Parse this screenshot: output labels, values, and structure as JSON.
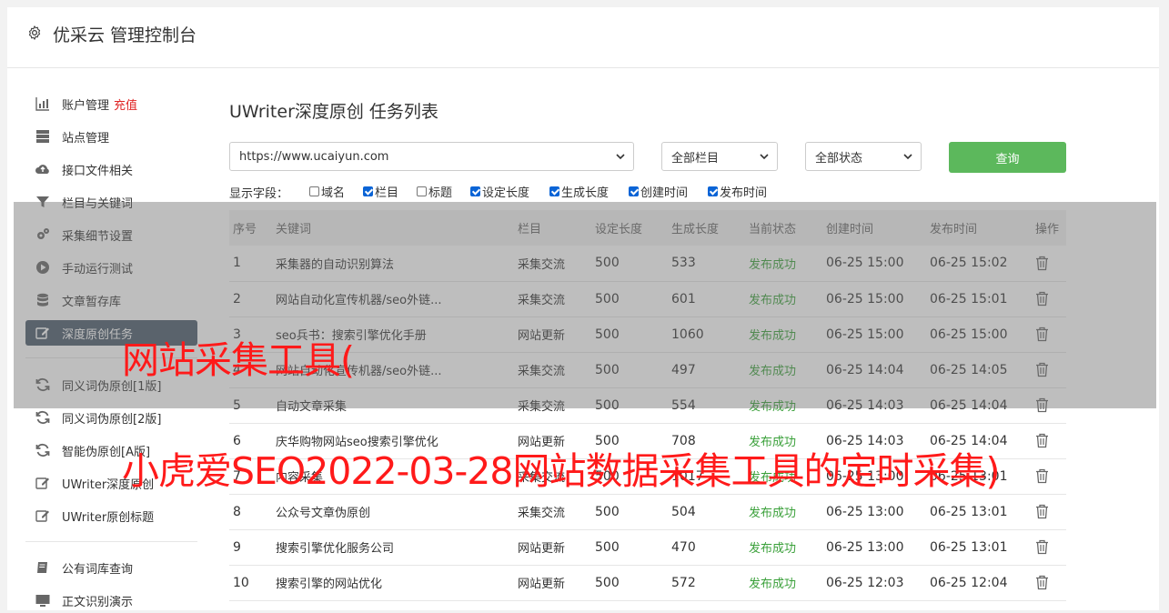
{
  "header": {
    "title": "优采云 管理控制台",
    "icon": "gear-icon"
  },
  "sidebar": {
    "items": [
      {
        "label": "账户管理",
        "badge": "充值",
        "icon": "bar-chart-icon"
      },
      {
        "label": "站点管理",
        "icon": "server-icon"
      },
      {
        "label": "接口文件相关",
        "icon": "cloud-upload-icon"
      },
      {
        "label": "栏目与关键词",
        "icon": "filter-icon"
      },
      {
        "label": "采集细节设置",
        "icon": "cogs-icon"
      },
      {
        "label": "手动运行测试",
        "icon": "play-circle-icon"
      },
      {
        "label": "文章暂存库",
        "icon": "database-icon"
      },
      {
        "label": "深度原创任务",
        "icon": "edit-icon"
      },
      {
        "label": "同义词伪原创[1版]",
        "icon": "refresh-icon"
      },
      {
        "label": "同义词伪原创[2版]",
        "icon": "refresh-icon"
      },
      {
        "label": "智能伪原创[A版]",
        "icon": "refresh-icon"
      },
      {
        "label": "UWriter深度原创",
        "icon": "edit-icon"
      },
      {
        "label": "UWriter原创标题",
        "icon": "edit-icon"
      },
      {
        "label": "公有词库查询",
        "icon": "book-icon"
      },
      {
        "label": "正文识别演示",
        "icon": "monitor-icon"
      }
    ]
  },
  "page": {
    "title": "UWriter深度原创 任务列表"
  },
  "filters": {
    "site": "https://www.ucaiyun.com",
    "category": "全部栏目",
    "status": "全部状态",
    "query_label": "查询"
  },
  "fields": {
    "label": "显示字段：",
    "options": [
      {
        "label": "域名",
        "checked": false
      },
      {
        "label": "栏目",
        "checked": true
      },
      {
        "label": "标题",
        "checked": false
      },
      {
        "label": "设定长度",
        "checked": true
      },
      {
        "label": "生成长度",
        "checked": true
      },
      {
        "label": "创建时间",
        "checked": true
      },
      {
        "label": "发布时间",
        "checked": true
      }
    ]
  },
  "table": {
    "headers": [
      "序号",
      "关键词",
      "栏目",
      "设定长度",
      "生成长度",
      "当前状态",
      "创建时间",
      "发布时间",
      "操作"
    ],
    "rows": [
      [
        "1",
        "采集器的自动识别算法",
        "采集交流",
        "500",
        "533",
        "发布成功",
        "06-25 15:00",
        "06-25 15:02"
      ],
      [
        "2",
        "网站自动化宣传机器/seo外链...",
        "采集交流",
        "500",
        "601",
        "发布成功",
        "06-25 15:00",
        "06-25 15:01"
      ],
      [
        "3",
        "seo兵书：搜索引擎优化手册",
        "网站更新",
        "500",
        "1060",
        "发布成功",
        "06-25 15:00",
        "06-25 15:00"
      ],
      [
        "4",
        "网站自动化宣传机器/seo外链...",
        "采集交流",
        "500",
        "497",
        "发布成功",
        "06-25 14:04",
        "06-25 14:05"
      ],
      [
        "5",
        "自动文章采集",
        "采集交流",
        "500",
        "554",
        "发布成功",
        "06-25 14:03",
        "06-25 14:04"
      ],
      [
        "6",
        "庆华购物网站seo搜索引擎优化",
        "网站更新",
        "500",
        "708",
        "发布成功",
        "06-25 14:03",
        "06-25 14:04"
      ],
      [
        "7",
        "内容采集",
        "采集交流",
        "500",
        "1017",
        "发布成功",
        "06-25 13:00",
        "06-25 13:01"
      ],
      [
        "8",
        "公众号文章伪原创",
        "采集交流",
        "500",
        "504",
        "发布成功",
        "06-25 13:00",
        "06-25 13:01"
      ],
      [
        "9",
        "搜索引擎优化服务公司",
        "网站更新",
        "500",
        "470",
        "发布成功",
        "06-25 13:00",
        "06-25 13:01"
      ],
      [
        "10",
        "搜索引擎的网站优化",
        "网站更新",
        "500",
        "572",
        "发布成功",
        "06-25 12:03",
        "06-25 12:04"
      ]
    ]
  },
  "watermark": {
    "line1": "网站采集工具(",
    "line2": "小虎爱SEO2022-03-28网站数据采集工具的定时采集)"
  },
  "colors": {
    "accent": "#5cb85c",
    "status_ok": "#3aa03a",
    "recharge": "#e02424",
    "watermark": "#ff1a1a",
    "active_item": "#4a5a6a"
  }
}
